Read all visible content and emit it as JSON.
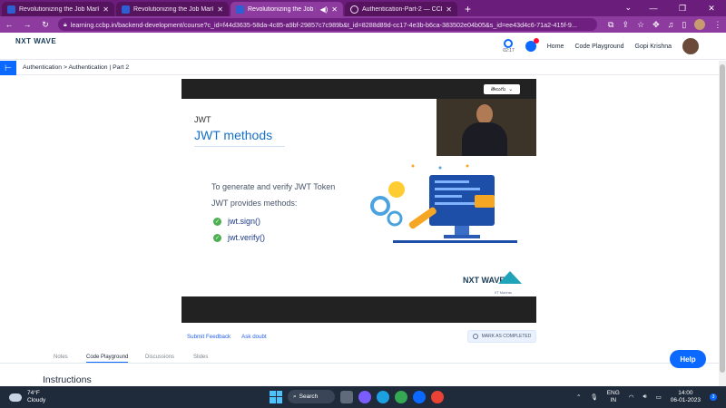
{
  "browser": {
    "tabs": [
      {
        "label": "Revolutionizing the Job Market |",
        "active": false
      },
      {
        "label": "Revolutionizing the Job Market |",
        "active": false
      },
      {
        "label": "Revolutionizing the Job Mar",
        "active": true
      },
      {
        "label": "Authentication-Part-2 — CCBP II",
        "active": false
      }
    ],
    "new_tab": "+",
    "url": "learning.ccbp.in/backend-development/course?c_id=f44d3635-58da-4c85-a9bf-29857c7c989b&t_id=8288d89d-cc17-4e3b-b6ca-383502e04b05&s_id=ee43d4c6-71a2-415f-9..."
  },
  "header": {
    "logo": "NXT WAVE",
    "timer_text": "02:17",
    "nav": [
      "Home",
      "Code Playground"
    ],
    "user_name": "Gopi Krishna"
  },
  "breadcrumb": "Authentication > Authentication | Part 2",
  "video": {
    "language": "తెలుగు",
    "slide": {
      "tag": "JWT",
      "title": "JWT methods",
      "line1": "To generate and verify JWT Token",
      "line2": "JWT provides methods:",
      "methods": [
        "jwt.sign()",
        "jwt.verify()"
      ],
      "brand": "NXT WAVE",
      "partner": "IIT Madras"
    }
  },
  "actions": {
    "submit_feedback": "Submit Feedback",
    "ask_doubt": "Ask doubt",
    "mark_completed": "MARK AS COMPLETED"
  },
  "content_tabs": [
    "Notes",
    "Code Playground",
    "Discussions",
    "Slides"
  ],
  "section_title": "Instructions",
  "help_button": "Help",
  "taskbar": {
    "temp": "74°F",
    "weather": "Cloudy",
    "search": "Search",
    "lang1": "ENG",
    "lang2": "IN",
    "time": "14:00",
    "date": "06-01-2023",
    "notif_count": "3"
  }
}
